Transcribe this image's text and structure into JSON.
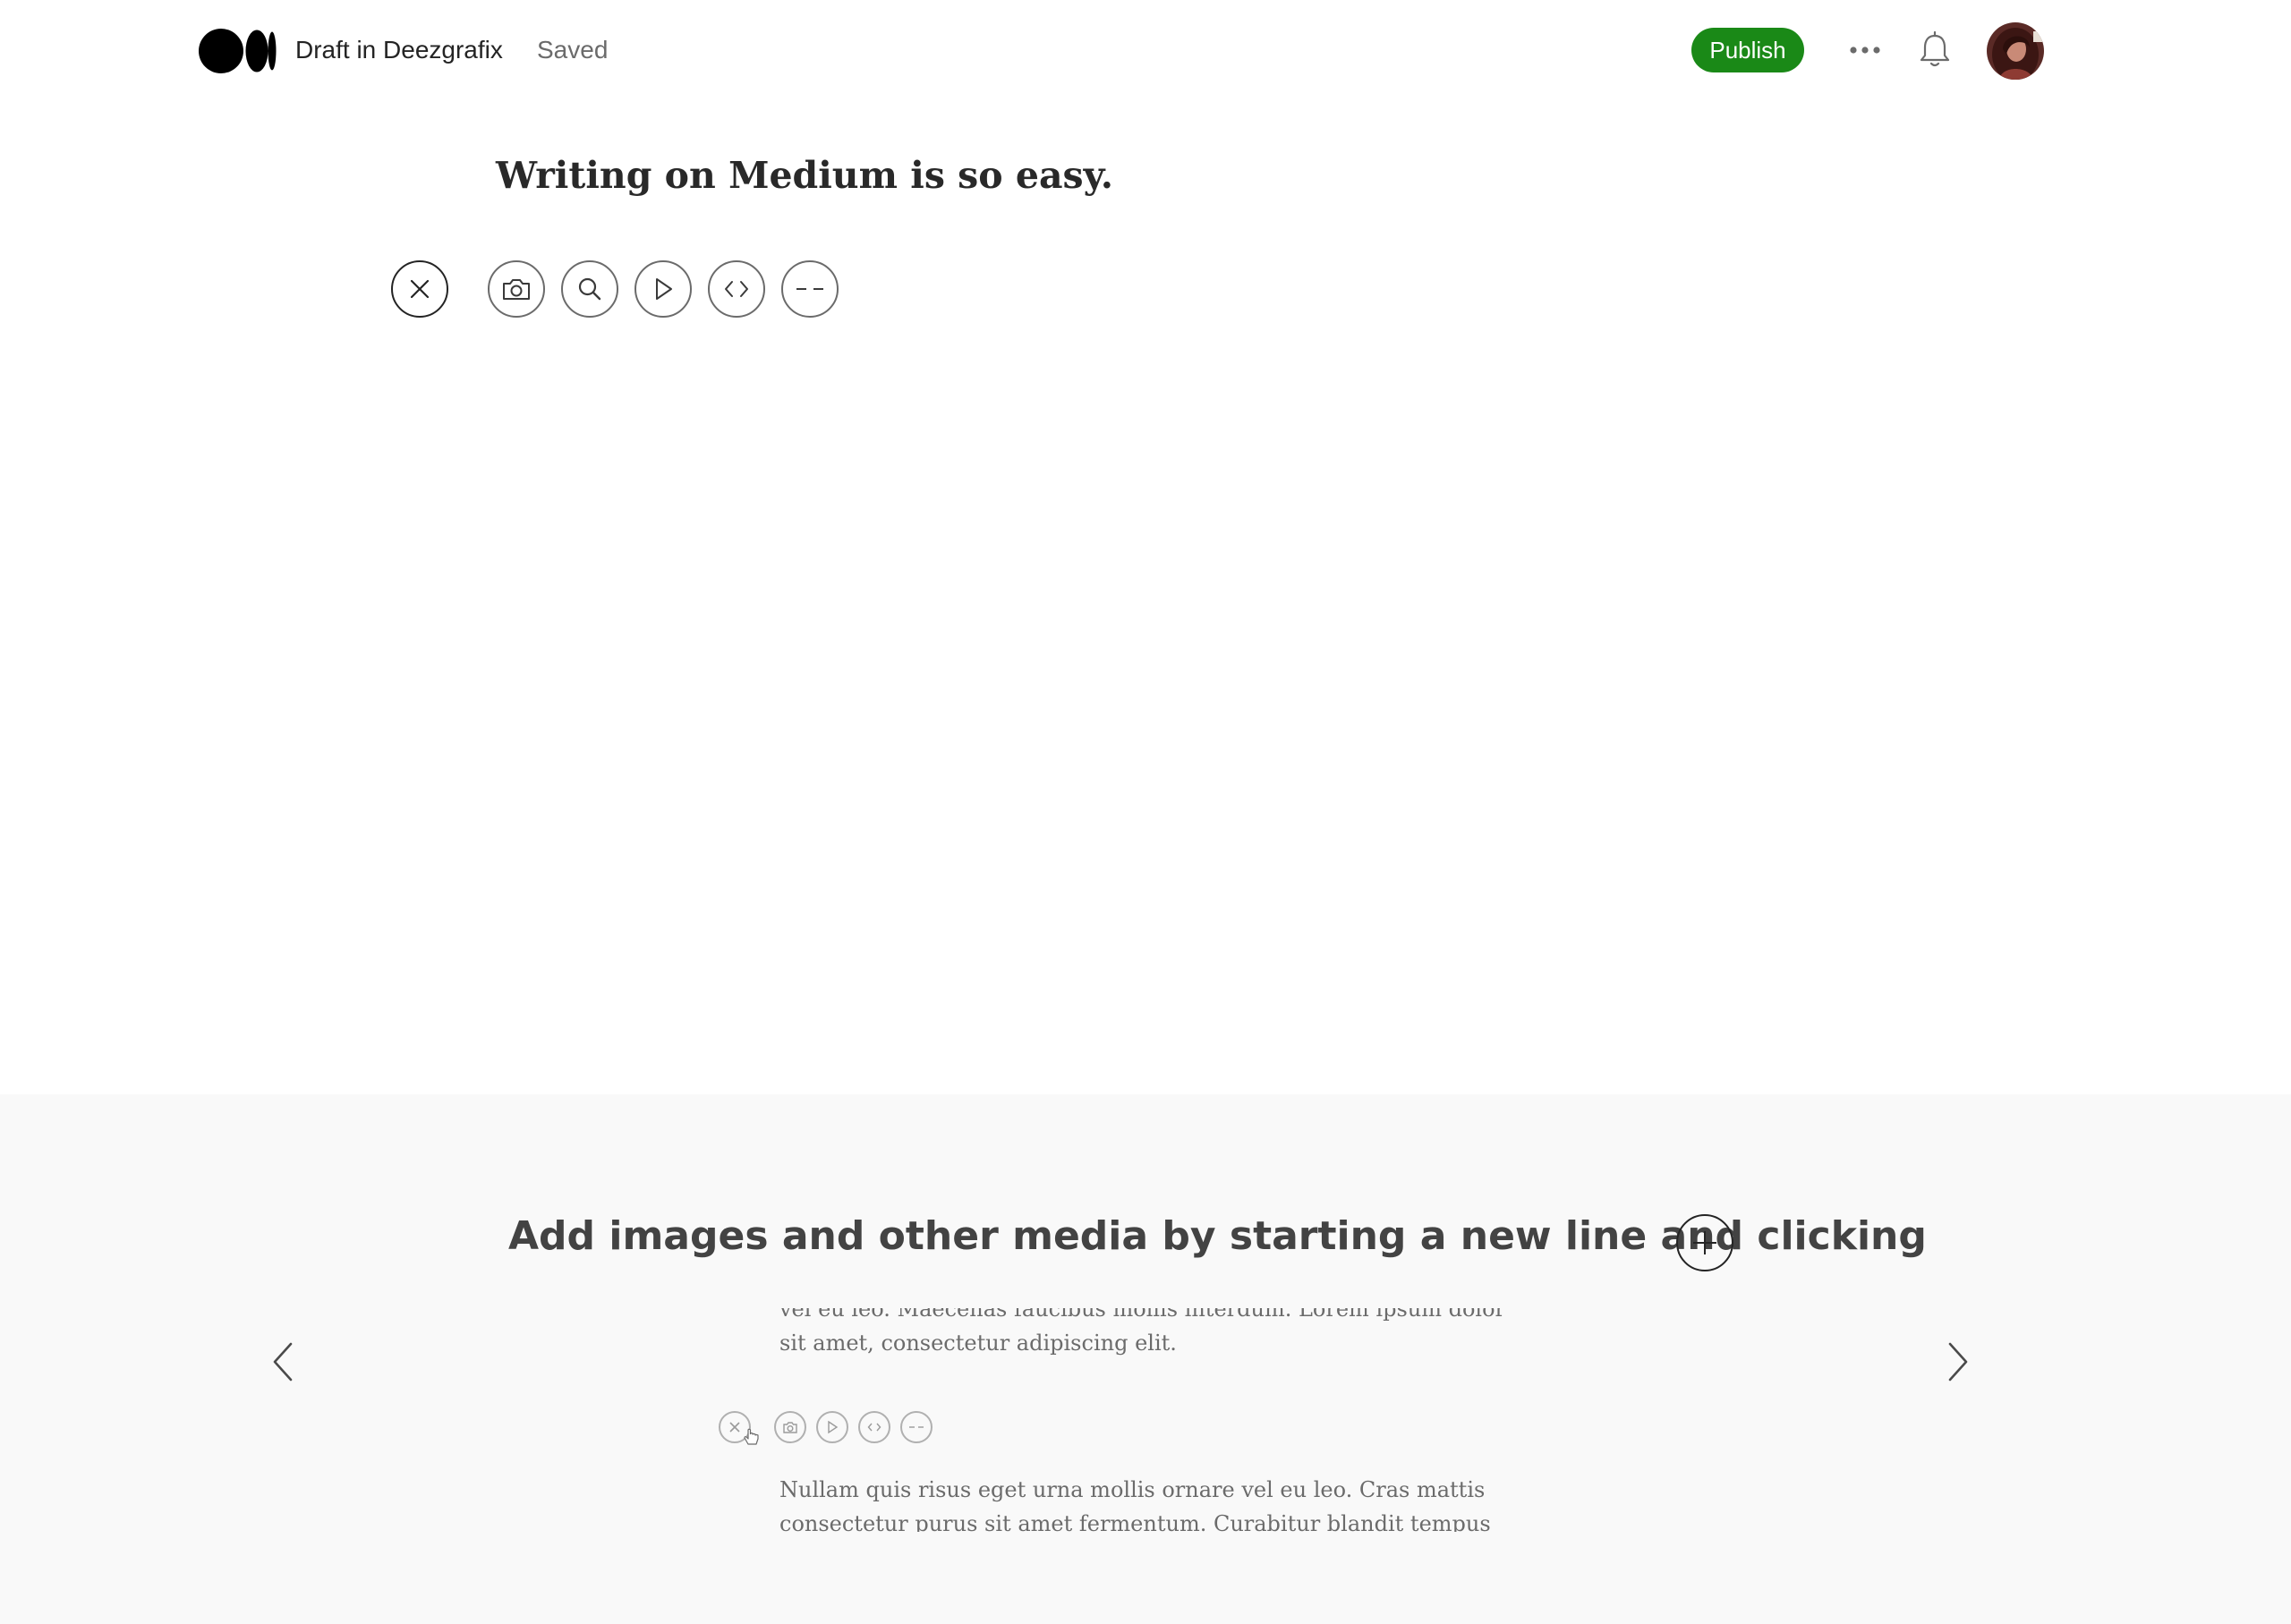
{
  "header": {
    "logo_icon": "medium-logo-icon",
    "draft_title": "Draft in Deezgrafix",
    "status": "Saved",
    "publish_label": "Publish",
    "more_icon": "more-horizontal-icon",
    "notifications_icon": "bell-icon",
    "avatar_icon": "user-avatar",
    "accent_color": "#1a8917"
  },
  "editor": {
    "title": "Writing on Medium is so easy.",
    "insert_toolbar": [
      {
        "name": "close",
        "icon": "close-icon"
      },
      {
        "name": "image",
        "icon": "camera-icon"
      },
      {
        "name": "unsplash",
        "icon": "search-icon"
      },
      {
        "name": "video",
        "icon": "play-icon"
      },
      {
        "name": "embed",
        "icon": "code-icon"
      },
      {
        "name": "separator",
        "icon": "dashes-icon"
      }
    ]
  },
  "tutorial": {
    "heading": "Add images and other media by starting a new line and clicking",
    "plus_icon": "plus-icon",
    "prev_icon": "chevron-left-icon",
    "next_icon": "chevron-right-icon",
    "preview": {
      "text_top": "vel eu leo. Maecenas faucibus mollis interdum. Lorem ipsum dolor sit amet, consectetur adipiscing elit.",
      "text_bottom": "Nullam quis risus eget urna mollis ornare vel eu leo. Cras mattis consectetur purus sit amet fermentum. Curabitur blandit tempus porttitor. Donec id elit"
    }
  }
}
